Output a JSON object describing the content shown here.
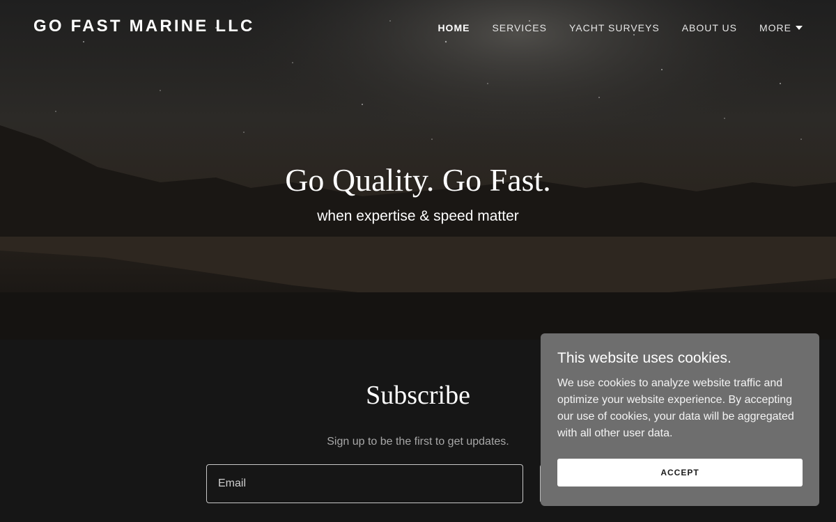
{
  "header": {
    "logo": "GO FAST MARINE LLC",
    "nav": [
      {
        "label": "HOME"
      },
      {
        "label": "SERVICES"
      },
      {
        "label": "YACHT SURVEYS"
      },
      {
        "label": "ABOUT US"
      },
      {
        "label": "MORE"
      }
    ]
  },
  "hero": {
    "headline": "Go Quality. Go Fast.",
    "subheadline": "when expertise & speed matter"
  },
  "subscribe": {
    "title": "Subscribe",
    "text": "Sign up to be the first to get updates.",
    "email_placeholder": "Email"
  },
  "cookie_banner": {
    "title": "This website uses cookies.",
    "body": "We use cookies to analyze website traffic and optimize your website experience. By accepting our use of cookies, your data will be aggregated with all other user data.",
    "accept_label": "ACCEPT"
  },
  "colors": {
    "page_background": "#161616",
    "cookie_background": "#6e6e6e",
    "text": "#ffffff"
  },
  "icons": [
    "caret-down-icon"
  ]
}
